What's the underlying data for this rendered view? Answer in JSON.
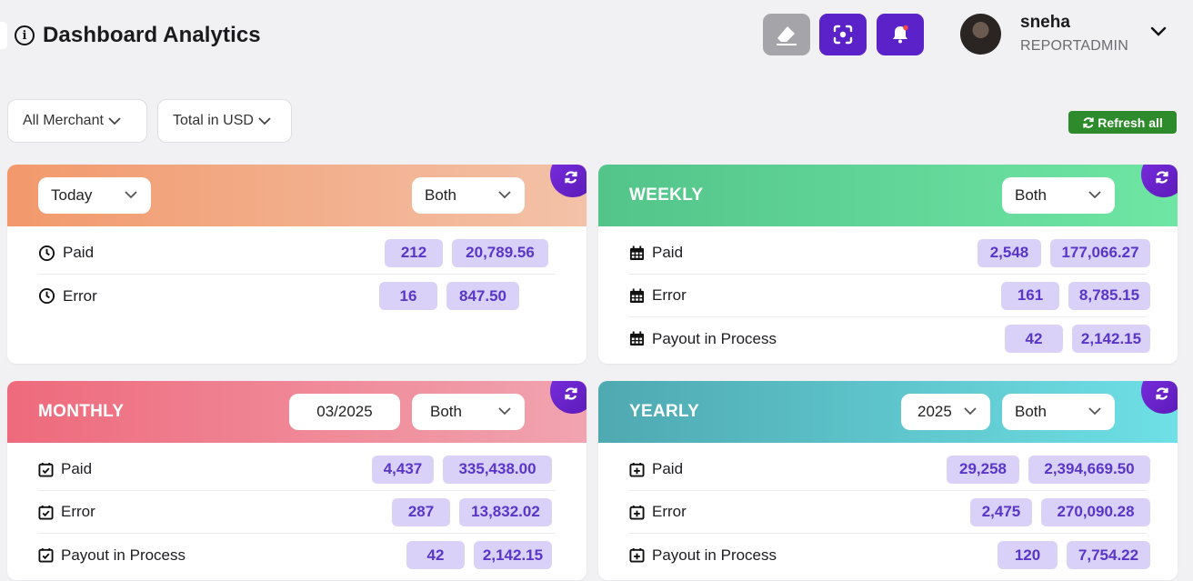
{
  "header": {
    "title": "Dashboard Analytics"
  },
  "toolbar": {
    "icons": [
      "eraser-icon",
      "screenshot-icon",
      "bell-icon"
    ]
  },
  "user": {
    "name": "sneha",
    "role": "REPORTADMIN"
  },
  "filters": {
    "merchant": "All Merchant",
    "currency": "Total in USD"
  },
  "refresh_all": "Refresh all",
  "cards": {
    "today": {
      "period": "Today",
      "type": "Both",
      "rows": [
        {
          "label": "Paid",
          "count": "212",
          "amount": "20,789.56"
        },
        {
          "label": "Error",
          "count": "16",
          "amount": "847.50"
        }
      ]
    },
    "weekly": {
      "title": "WEEKLY",
      "type": "Both",
      "rows": [
        {
          "label": "Paid",
          "count": "2,548",
          "amount": "177,066.27"
        },
        {
          "label": "Error",
          "count": "161",
          "amount": "8,785.15"
        },
        {
          "label": "Payout in Process",
          "count": "42",
          "amount": "2,142.15"
        }
      ]
    },
    "monthly": {
      "title": "MONTHLY",
      "month": "03/2025",
      "type": "Both",
      "rows": [
        {
          "label": "Paid",
          "count": "4,437",
          "amount": "335,438.00"
        },
        {
          "label": "Error",
          "count": "287",
          "amount": "13,832.02"
        },
        {
          "label": "Payout in Process",
          "count": "42",
          "amount": "2,142.15"
        }
      ]
    },
    "yearly": {
      "title": "YEARLY",
      "year": "2025",
      "type": "Both",
      "rows": [
        {
          "label": "Paid",
          "count": "29,258",
          "amount": "2,394,669.50"
        },
        {
          "label": "Error",
          "count": "2,475",
          "amount": "270,090.28"
        },
        {
          "label": "Payout in Process",
          "count": "120",
          "amount": "7,754.22"
        }
      ]
    }
  }
}
